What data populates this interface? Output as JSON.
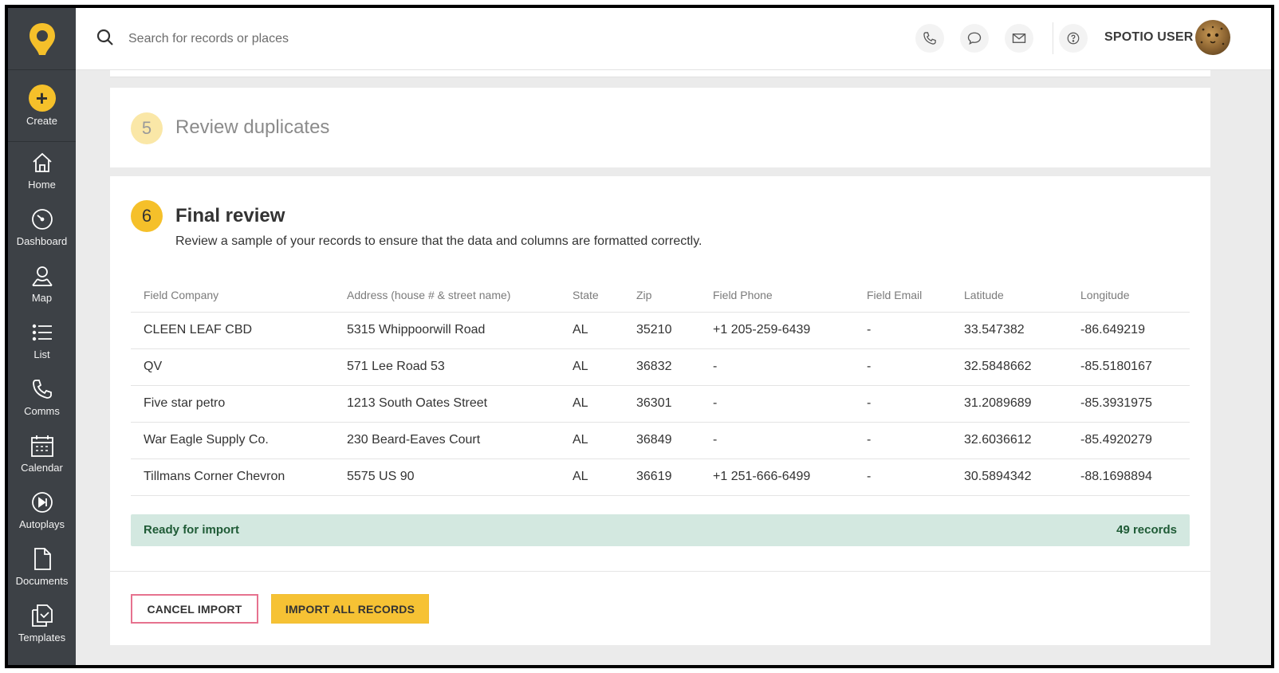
{
  "sidebar": {
    "create_label": "Create",
    "items": [
      {
        "label": "Home",
        "icon": "home-icon"
      },
      {
        "label": "Dashboard",
        "icon": "speedometer-icon"
      },
      {
        "label": "Map",
        "icon": "map-person-icon"
      },
      {
        "label": "List",
        "icon": "list-icon"
      },
      {
        "label": "Comms",
        "icon": "phone-icon"
      },
      {
        "label": "Calendar",
        "icon": "calendar-icon"
      },
      {
        "label": "Autoplays",
        "icon": "play-next-icon"
      },
      {
        "label": "Documents",
        "icon": "document-icon"
      },
      {
        "label": "Templates",
        "icon": "templates-icon"
      }
    ]
  },
  "header": {
    "search_placeholder": "Search for records or places",
    "user_name": "SPOTIO USER"
  },
  "steps": {
    "review_duplicates": {
      "number": "5",
      "title": "Review duplicates"
    },
    "final_review": {
      "number": "6",
      "title": "Final review",
      "subtitle": "Review a sample of your records to ensure that the data and columns are formatted correctly."
    }
  },
  "table": {
    "columns": [
      "Field Company",
      "Address (house # & street name)",
      "State",
      "Zip",
      "Field Phone",
      "Field Email",
      "Latitude",
      "Longitude"
    ],
    "rows": [
      [
        "CLEEN LEAF CBD",
        "5315 Whippoorwill Road",
        "AL",
        "35210",
        "+1 205-259-6439",
        "-",
        "33.547382",
        "-86.649219"
      ],
      [
        "QV",
        "571 Lee Road 53",
        "AL",
        "36832",
        "-",
        "-",
        "32.5848662",
        "-85.5180167"
      ],
      [
        "Five star petro",
        "1213 South Oates Street",
        "AL",
        "36301",
        "-",
        "-",
        "31.2089689",
        "-85.3931975"
      ],
      [
        "War Eagle Supply Co.",
        "230 Beard-Eaves Court",
        "AL",
        "36849",
        "-",
        "-",
        "32.6036612",
        "-85.4920279"
      ],
      [
        "Tillmans Corner Chevron",
        "5575 US 90",
        "AL",
        "36619",
        "+1 251-666-6499",
        "-",
        "30.5894342",
        "-88.1698894"
      ]
    ]
  },
  "status": {
    "ready_label": "Ready for import",
    "records_count": "49 records"
  },
  "buttons": {
    "cancel": "CANCEL IMPORT",
    "import_all": "IMPORT ALL RECORDS"
  },
  "colors": {
    "accent": "#f5c02a",
    "sidebar_bg": "#3d4146",
    "ready_bg": "#d3e8e0",
    "ready_text": "#1f5b36",
    "cancel_border": "#e6728f"
  }
}
